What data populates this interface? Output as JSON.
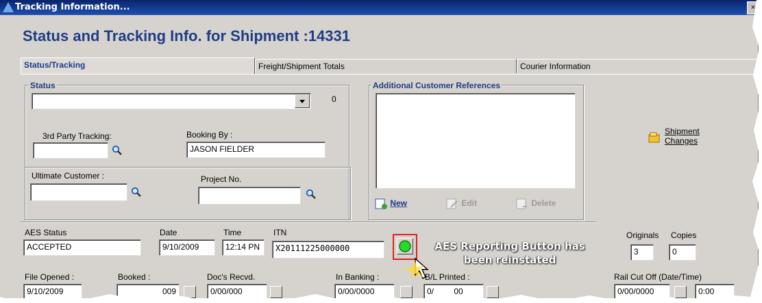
{
  "window": {
    "title": "Tracking Information...",
    "close_symbol": "×"
  },
  "heading": "Status and Tracking Info. for Shipment :14331",
  "tabs": [
    {
      "label": "Status/Tracking",
      "active": true
    },
    {
      "label": "Freight/Shipment Totals",
      "active": false
    },
    {
      "label": "Courier Information",
      "active": false
    }
  ],
  "status": {
    "group_label": "Status",
    "value": "",
    "count": "0",
    "third_party_label": "3rd Party Tracking:",
    "third_party_value": "",
    "booking_by_label": "Booking By :",
    "booking_by_value": "JASON FIELDER",
    "ultimate_customer_label": "Ultimate Customer :",
    "ultimate_customer_value": "",
    "project_no_label": "Project No.",
    "project_no_value": ""
  },
  "references": {
    "group_label": "Additional Customer References",
    "new_label": "New",
    "edit_label": "Edit",
    "delete_label": "Delete"
  },
  "shipment_changes_label": "Shipment Changes",
  "aes": {
    "status_label": "AES Status",
    "status_value": "ACCEPTED",
    "date_label": "Date",
    "date_value": "9/10/2009",
    "time_label": "Time",
    "time_value": "12:14 PN",
    "itn_label": "ITN",
    "itn_value": "X20111225000000"
  },
  "originals_label": "Originals",
  "originals_value": "3",
  "copies_label": "Copies",
  "copies_value": "0",
  "callout": "AES Reporting Button has been reinstated",
  "bottom": {
    "file_opened_label": "File Opened :",
    "file_opened_value": "9/10/2009",
    "booked_label": "Booked :",
    "booked_value": "009",
    "docs_recvd_label": "Doc's Recvd.",
    "docs_recvd_value": "0/00/000",
    "in_banking_label": "In Banking :",
    "in_banking_value": "0/00/0000",
    "bl_printed_label": "B/L Printed :",
    "bl_printed_value": "0/",
    "bl_printed_value2": "00",
    "rail_cutoff_label": "Rail Cut Off (Date/Time)",
    "rail_cutoff_date": "0/00/0000",
    "rail_cutoff_time": "0:00"
  },
  "colors": {
    "heading": "#1f3c86",
    "titlebar": "#0a246a",
    "panel": "#d6d3ce",
    "highlight_border": "#e02020",
    "aes_button": "#22dd22"
  }
}
